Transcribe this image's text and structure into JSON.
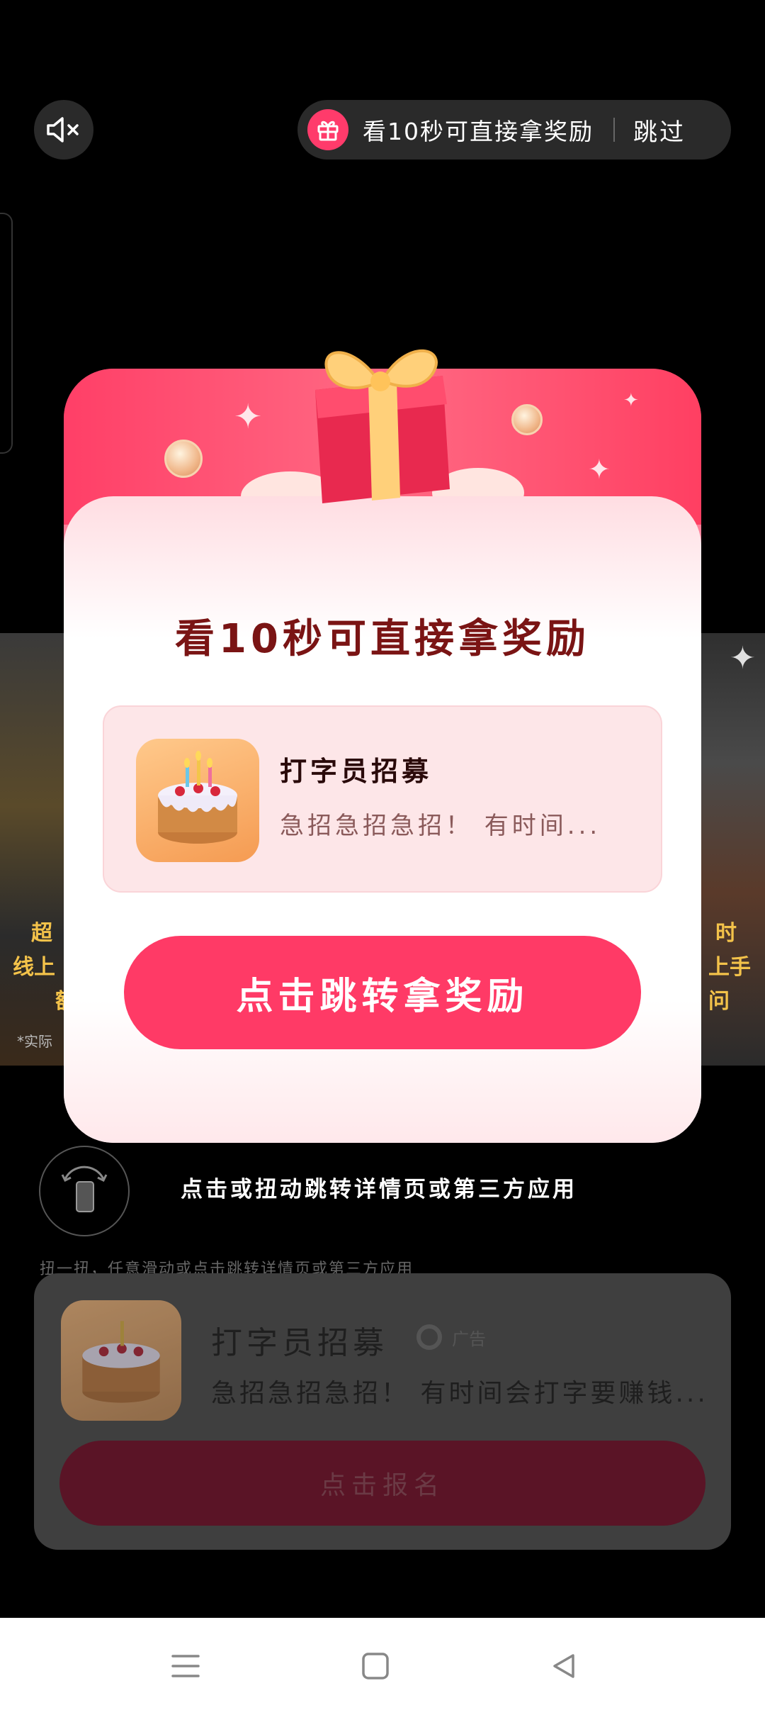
{
  "topbar": {
    "mute_icon": "speaker-mute-icon",
    "reward_text": "看10秒可直接拿奖励",
    "skip_label": "跳过"
  },
  "modal": {
    "title": "看10秒可直接拿奖励",
    "app_card": {
      "name": "打字员招募",
      "description": "急招急招急招！ 有时间..."
    },
    "cta_label": "点击跳转拿奖励"
  },
  "background": {
    "left_lines": [
      "超",
      "线上",
      "额"
    ],
    "right_lines": [
      "时",
      "上手",
      "问"
    ],
    "disclaimer": "*实际"
  },
  "twist": {
    "label": "点击或扭动跳转详情页或第三方应用",
    "hint": "扭一扭，任意滑动或点击跳转详情页或第三方应用"
  },
  "bottom_card": {
    "name": "打字员招募",
    "ad_label": "广告",
    "description": "急招急招急招！ 有时间会打字要赚钱...",
    "button_label": "点击报名"
  },
  "colors": {
    "accent": "#ff3a66",
    "title": "#7a1414"
  }
}
